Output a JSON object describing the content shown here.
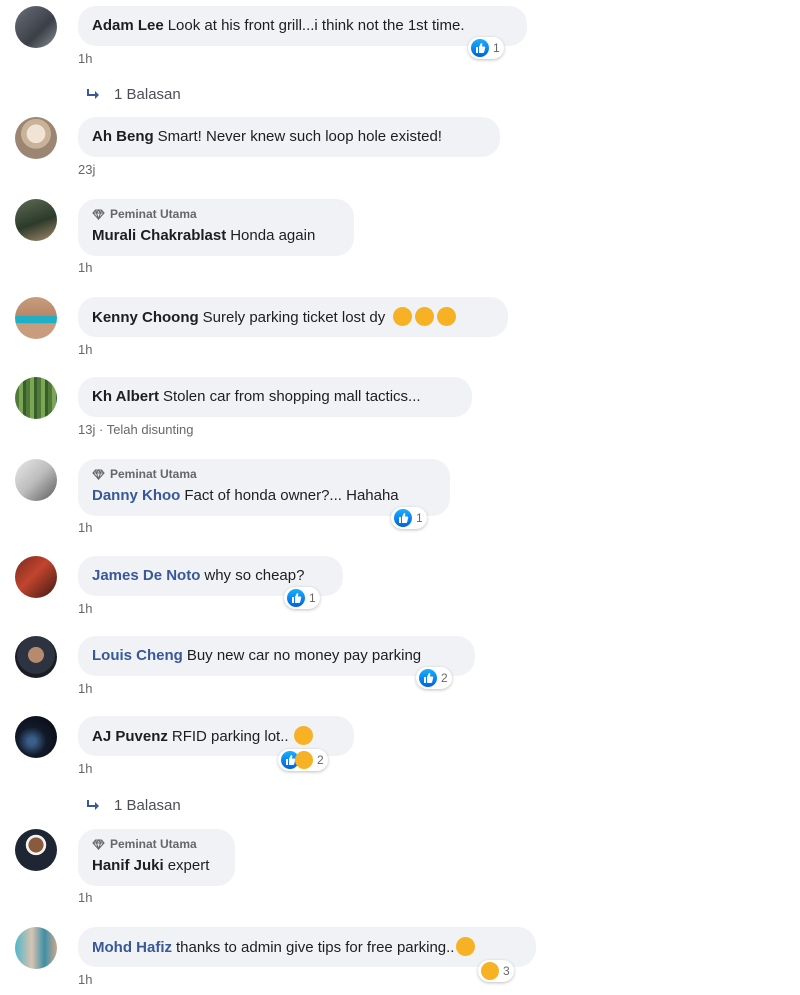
{
  "badge_label": "Peminat Utama",
  "comments": [
    {
      "author": "Adam Lee",
      "text": "Look at his front grill...i think not the 1st time.",
      "time": "1h",
      "reaction_count": "1",
      "reply_label": "1 Balasan"
    },
    {
      "author": "Ah Beng",
      "text": "Smart! Never knew such loop hole existed!",
      "time": "23j"
    },
    {
      "author": "Murali Chakrablast",
      "text": "Honda again",
      "time": "1h"
    },
    {
      "author": "Kenny Choong",
      "text": "Surely parking ticket lost dy",
      "time": "1h",
      "emojis": [
        "smirk-emoji",
        "sad-emoji",
        "steam-emoji"
      ]
    },
    {
      "author": "Kh Albert",
      "text": "Stolen car from shopping mall tactics...",
      "time": "13j",
      "edited": "· Telah disunting"
    },
    {
      "author": "Danny Khoo",
      "text": "Fact of honda owner?... Hahaha",
      "time": "1h",
      "reaction_count": "1"
    },
    {
      "author": "James De Noto",
      "text": "why so cheap?",
      "time": "1h",
      "reaction_count": "1"
    },
    {
      "author": "Louis Cheng",
      "text": "Buy new car no money pay parking",
      "time": "1h",
      "reaction_count": "2"
    },
    {
      "author": "AJ Puvenz",
      "text": "RFID parking lot..",
      "time": "1h",
      "reaction_count": "2",
      "reply_label": "1 Balasan",
      "emojis": [
        "tears-of-joy-emoji"
      ]
    },
    {
      "author": "Hanif Juki",
      "text": "expert",
      "time": "1h"
    },
    {
      "author": "Mohd Hafiz",
      "text": "thanks to admin give tips for free parking..",
      "time": "1h",
      "reaction_count": "3",
      "emojis": [
        "grin-sweat-emoji"
      ]
    }
  ],
  "colors": {
    "bubble": "#f0f2f5",
    "like": "#1877f2",
    "author_link": "#385898",
    "meta": "#65676b"
  }
}
